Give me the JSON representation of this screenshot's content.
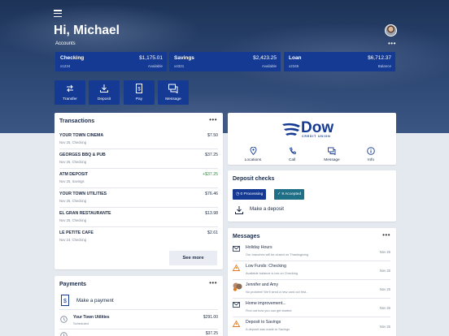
{
  "header": {
    "greeting": "Hi, Michael",
    "accounts_label": "Accounts",
    "more": "•••"
  },
  "accounts": [
    {
      "name": "Checking",
      "number": "x1234",
      "amount": "$1,175.01",
      "kind": "Available"
    },
    {
      "name": "Savings",
      "number": "x4321",
      "amount": "$2,423.25",
      "kind": "Available"
    },
    {
      "name": "Loan",
      "number": "x2345",
      "amount": "$6,712.37",
      "kind": "Balance"
    }
  ],
  "quick_actions": [
    {
      "label": "Transfer",
      "icon": "transfer-icon"
    },
    {
      "label": "Deposit",
      "icon": "deposit-icon"
    },
    {
      "label": "Pay",
      "icon": "pay-icon"
    },
    {
      "label": "Message",
      "icon": "message-icon"
    }
  ],
  "transactions": {
    "title": "Transactions",
    "more": "•••",
    "items": [
      {
        "name": "YOUR TOWN CINEMA",
        "detail": "Nov 25, Checking",
        "amount": "$7.50",
        "positive": false
      },
      {
        "name": "GEORGES BBQ & PUB",
        "detail": "Nov 25, Checking",
        "amount": "$37.25",
        "positive": false
      },
      {
        "name": "ATM DEPOSIT",
        "detail": "Nov 25, Savings",
        "amount": "+$37.25",
        "positive": true
      },
      {
        "name": "YOUR TOWN UTILITIES",
        "detail": "Nov 25, Checking",
        "amount": "$76.46",
        "positive": false
      },
      {
        "name": "EL GRAN RESTAURANTE",
        "detail": "Nov 25, Checking",
        "amount": "$13.98",
        "positive": false
      },
      {
        "name": "LE PETITE CAFE",
        "detail": "Nov 24, Checking",
        "amount": "$2.61",
        "positive": false
      }
    ],
    "see_more": "See more"
  },
  "payments": {
    "title": "Payments",
    "more": "•••",
    "make_payment": "Make a payment",
    "items": [
      {
        "name": "Your Town Utilities",
        "status": "Scheduled",
        "amount": "$291.00"
      },
      {
        "name": "",
        "status": "",
        "amount": "$37.25"
      }
    ]
  },
  "bank": {
    "logo_word": "Dow",
    "logo_sub": "CREDIT UNION",
    "links": [
      {
        "label": "Locations",
        "icon": "location-pin-icon"
      },
      {
        "label": "Call",
        "icon": "phone-icon"
      },
      {
        "label": "Message",
        "icon": "chat-icon"
      },
      {
        "label": "Info",
        "icon": "info-icon"
      }
    ]
  },
  "deposit_checks": {
    "title": "Deposit checks",
    "processing": "0 Processing",
    "accepted": "9 Accepted",
    "make_deposit": "Make a deposit"
  },
  "messages": {
    "title": "Messages",
    "more": "•••",
    "items": [
      {
        "title": "Holiday Hours",
        "preview": "Our branches will be closed on Thanksgiving",
        "date": "Nov 25",
        "icon": "envelope-icon"
      },
      {
        "title": "Low Funds: Checking",
        "preview": "Available balance is low on Checking",
        "date": "Nov 25",
        "icon": "warning-icon"
      },
      {
        "title": "Jennifer and Amy",
        "preview": "No problem! We'll send a new card out first...",
        "date": "Nov 25",
        "icon": "avatar-group-icon"
      },
      {
        "title": "Home improvement...",
        "preview": "Find out how you can get started",
        "date": "Nov 25",
        "icon": "envelope-icon"
      },
      {
        "title": "Deposit to Savings",
        "preview": "A deposit was made to Savings",
        "date": "Nov 25",
        "icon": "warning-icon"
      }
    ]
  },
  "colors": {
    "brand_blue": "#143a93",
    "positive_green": "#2d8b3a",
    "accepted_teal": "#1f6f86",
    "warning_orange": "#e07a1f"
  }
}
